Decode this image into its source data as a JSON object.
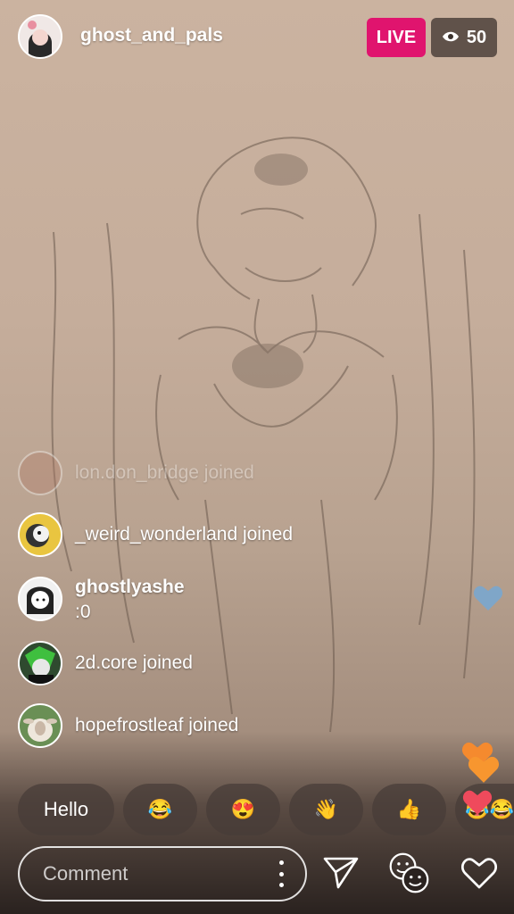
{
  "stream": {
    "host_username": "ghost_and_pals",
    "live_label": "LIVE",
    "viewer_count": "50",
    "colors": {
      "live_accent": "#e0146e",
      "heart_blue": "#7fa6c8",
      "heart_red": "#ef4a5c",
      "heart_orange": "#f58a2e"
    }
  },
  "comments": [
    {
      "text": "lon.don_bridge joined"
    },
    {
      "text": "_weird_wonderland joined"
    },
    {
      "username": "ghostlyashe",
      "text": ":0"
    },
    {
      "text": "2d.core joined"
    },
    {
      "text": "hopefrostleaf joined"
    }
  ],
  "quick_replies": [
    {
      "label": "Hello"
    },
    {
      "label": "😂"
    },
    {
      "label": "😍"
    },
    {
      "label": "👋"
    },
    {
      "label": "👍"
    },
    {
      "label": "😂😂"
    }
  ],
  "bottom_bar": {
    "comment_placeholder": "Comment",
    "icons": [
      "more-options-icon",
      "send-icon",
      "face-filter-icon",
      "heart-icon"
    ]
  }
}
